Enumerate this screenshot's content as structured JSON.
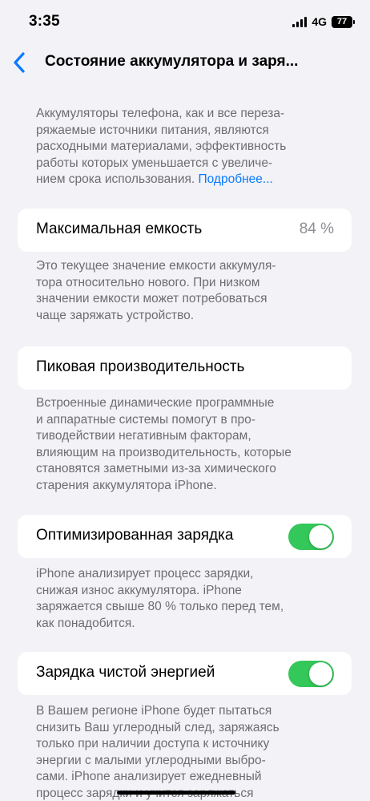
{
  "status_bar": {
    "time": "3:35",
    "network": "4G",
    "battery_level": "77"
  },
  "nav": {
    "back_icon": "chevron-left-icon",
    "title": "Состояние аккумулятора и заря..."
  },
  "intro": {
    "lines": [
      "Аккумуляторы телефона, как и все переза-",
      "ряжаемые источники питания, являются",
      "расходными материалами, эффективность",
      "работы которых уменьшается с увеличе-",
      "нием срока использования."
    ],
    "link": "Подробнее..."
  },
  "max_capacity": {
    "label": "Максимальная емкость",
    "value": "84 %",
    "desc_lines": [
      "Это текущее значение емкости аккумуля-",
      "тора относительно нового. При низком",
      "значении емкости может потребоваться",
      "чаще заряжать устройство."
    ]
  },
  "peak_performance": {
    "label": "Пиковая производительность",
    "desc_lines": [
      "Встроенные динамические программные",
      "и аппаратные системы помогут в про-",
      "тиводействии негативным факторам,",
      "влияющим на производительность, которые",
      "становятся заметными из-за химического",
      "старения аккумулятора iPhone."
    ]
  },
  "optimized_charging": {
    "label": "Оптимизированная зарядка",
    "enabled": true,
    "desc_lines": [
      "iPhone анализирует процесс зарядки,",
      "снижая износ аккумулятора. iPhone",
      "заряжается свыше 80 % только перед тем,",
      "как понадобится."
    ]
  },
  "clean_energy": {
    "label": "Зарядка чистой энергией",
    "enabled": true,
    "desc_lines": [
      "В Вашем регионе iPhone будет пытаться",
      "снизить Ваш углеродный след, заряжаясь",
      "только при наличии доступа к источнику",
      "энергии с малыми углеродными выбро-",
      "сами. iPhone анализирует ежедневный",
      "процесс зарядки и учится заряжаться"
    ]
  },
  "colors": {
    "background": "#f2f2f7",
    "accent": "#0a7aff",
    "toggle_on": "#34c759",
    "secondary_text": "#6d6d72"
  }
}
